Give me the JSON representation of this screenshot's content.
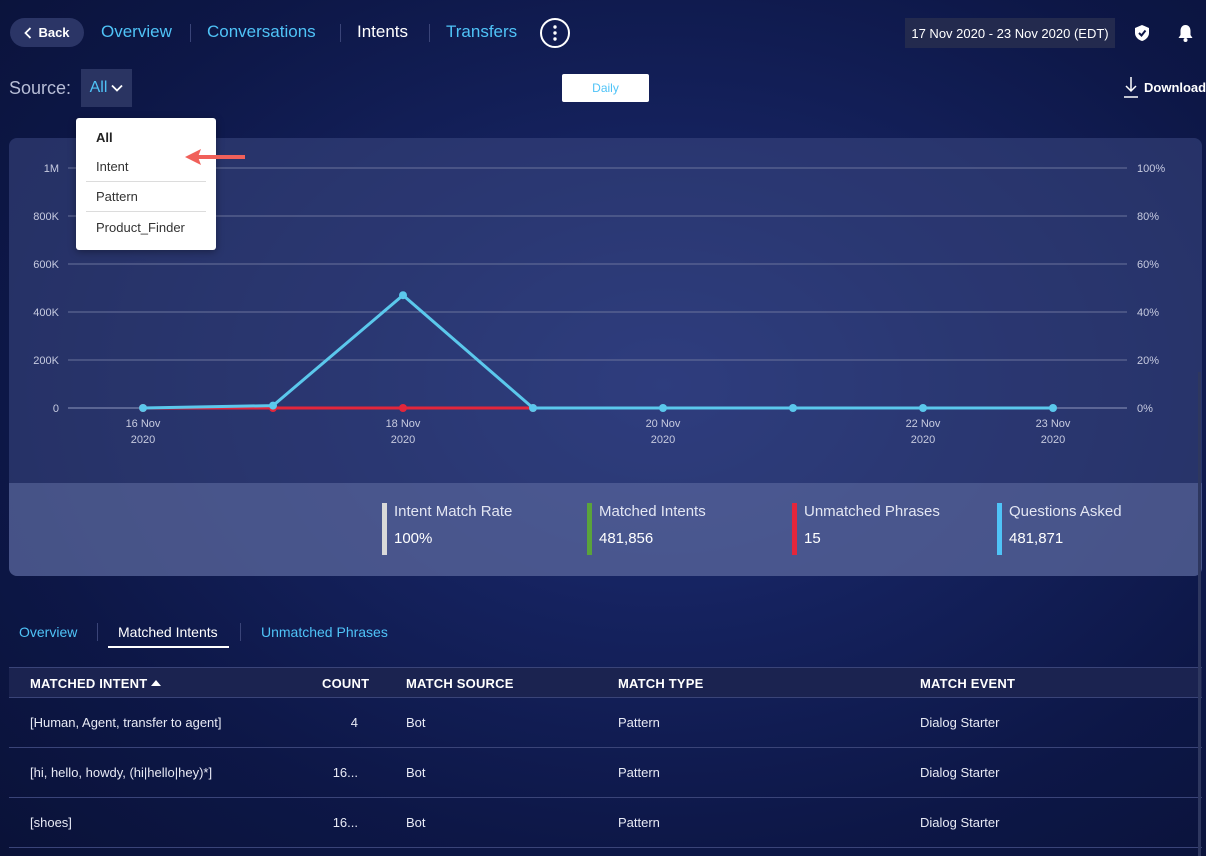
{
  "nav": {
    "back_label": "Back",
    "tabs": [
      {
        "label": "Overview"
      },
      {
        "label": "Conversations"
      },
      {
        "label": "Intents"
      },
      {
        "label": "Transfers"
      }
    ],
    "date_range": "17 Nov 2020 - 23 Nov 2020 (EDT)"
  },
  "toolbar": {
    "source_label": "Source:",
    "source_value": "All",
    "daily_label": "Daily",
    "download_label": "Download"
  },
  "dropdown": {
    "options": [
      "All",
      "Intent",
      "Pattern",
      "Product_Finder"
    ],
    "selected": "All"
  },
  "chart_data": {
    "type": "line",
    "x": [
      "16 Nov 2020",
      "17 Nov 2020",
      "18 Nov 2020",
      "19 Nov 2020",
      "20 Nov 2020",
      "21 Nov 2020",
      "22 Nov 2020",
      "23 Nov 2020"
    ],
    "x_tick_labels": [
      {
        "line1": "16 Nov",
        "line2": "2020",
        "index": 0
      },
      {
        "line1": "18 Nov",
        "line2": "2020",
        "index": 2
      },
      {
        "line1": "20 Nov",
        "line2": "2020",
        "index": 4
      },
      {
        "line1": "22 Nov",
        "line2": "2020",
        "index": 6
      },
      {
        "line1": "23 Nov",
        "line2": "2020",
        "index": 7
      }
    ],
    "y_ticks_left": [
      "0",
      "200K",
      "400K",
      "600K",
      "800K",
      "1M"
    ],
    "y_ticks_right": [
      "0%",
      "20%",
      "40%",
      "60%",
      "80%",
      "100%"
    ],
    "ylim": [
      0,
      1000000
    ],
    "grid": true,
    "series": [
      {
        "color": "#5bc8ec",
        "values": [
          0,
          10000,
          470000,
          0,
          0,
          0,
          0,
          0
        ]
      },
      {
        "color": "#e3263b",
        "values": [
          0,
          0,
          0,
          0,
          null,
          null,
          null,
          null
        ]
      }
    ]
  },
  "stats": [
    {
      "label": "Intent Match Rate",
      "value": "100%",
      "color": "#d9d9d9"
    },
    {
      "label": "Matched Intents",
      "value": "481,856",
      "color": "#5aa33b"
    },
    {
      "label": "Unmatched Phrases",
      "value": "15",
      "color": "#e3263b"
    },
    {
      "label": "Questions Asked",
      "value": "481,871",
      "color": "#4fc3f7"
    }
  ],
  "subtabs": [
    {
      "label": "Overview"
    },
    {
      "label": "Matched Intents"
    },
    {
      "label": "Unmatched Phrases"
    }
  ],
  "table": {
    "headers": [
      "MATCHED INTENT",
      "COUNT",
      "MATCH SOURCE",
      "MATCH TYPE",
      "MATCH EVENT"
    ],
    "rows": [
      [
        "[Human, Agent, transfer to agent]",
        "4",
        "Bot",
        "Pattern",
        "Dialog Starter"
      ],
      [
        "[hi, hello, howdy, (hi|hello|hey)*]",
        "16...",
        "Bot",
        "Pattern",
        "Dialog Starter"
      ],
      [
        "[shoes]",
        "16...",
        "Bot",
        "Pattern",
        "Dialog Starter"
      ]
    ]
  }
}
